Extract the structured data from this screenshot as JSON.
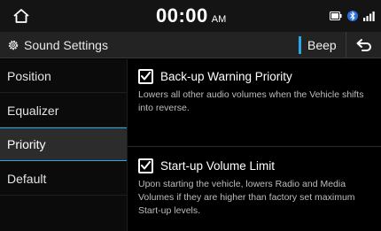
{
  "status_bar": {
    "time": "00:00",
    "ampm": "AM",
    "icons": [
      "home-icon",
      "media-indicator-icon",
      "bluetooth-icon",
      "signal-icon"
    ]
  },
  "header": {
    "title": "Sound Settings",
    "title_icon": "gear-icon",
    "beep_label": "Beep",
    "back_icon": "back-arrow-icon"
  },
  "sidebar": {
    "items": [
      {
        "label": "Position",
        "selected": false
      },
      {
        "label": "Equalizer",
        "selected": false
      },
      {
        "label": "Priority",
        "selected": true
      },
      {
        "label": "Default",
        "selected": false
      }
    ]
  },
  "main": {
    "options": [
      {
        "label": "Back-up Warning Priority",
        "checked": true,
        "description": "Lowers all other audio volumes when the Vehicle shifts into reverse."
      },
      {
        "label": "Start-up Volume Limit",
        "checked": true,
        "description": "Upon starting the vehicle, lowers Radio and Media Volumes if they are higher than factory set maximum Start-up levels."
      }
    ]
  },
  "colors": {
    "accent": "#2aa6e8",
    "background": "#000000",
    "header_bg": "#232323",
    "selected_bg": "#2c2c2c"
  }
}
